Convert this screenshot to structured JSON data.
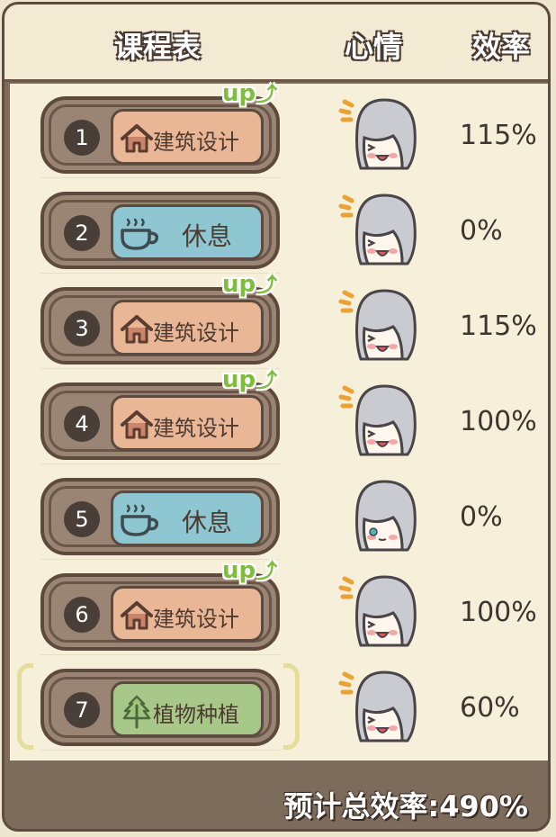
{
  "header": {
    "schedule": "课程表",
    "mood": "心情",
    "efficiency": "效率"
  },
  "rows": [
    {
      "number": "1",
      "course": "建筑设计",
      "type": "build",
      "up": true,
      "efficiency": "115%",
      "mood": "happy"
    },
    {
      "number": "2",
      "course": "休息",
      "type": "rest",
      "up": false,
      "efficiency": "0%",
      "mood": "happy"
    },
    {
      "number": "3",
      "course": "建筑设计",
      "type": "build",
      "up": true,
      "efficiency": "115%",
      "mood": "happy"
    },
    {
      "number": "4",
      "course": "建筑设计",
      "type": "build",
      "up": true,
      "efficiency": "100%",
      "mood": "happy"
    },
    {
      "number": "5",
      "course": "休息",
      "type": "rest",
      "up": false,
      "efficiency": "0%",
      "mood": "calm"
    },
    {
      "number": "6",
      "course": "建筑设计",
      "type": "build",
      "up": true,
      "efficiency": "100%",
      "mood": "happy"
    },
    {
      "number": "7",
      "course": "植物种植",
      "type": "plant",
      "up": false,
      "efficiency": "60%",
      "mood": "happy",
      "selected": true
    }
  ],
  "up_label": "up",
  "footer": {
    "total": "预计总效率:490%"
  },
  "colors": {
    "build": "#e9b796",
    "rest": "#8ec6d1",
    "plant": "#a8c88a",
    "frame": "#5f4b3f",
    "up": "#7fbd3e"
  }
}
